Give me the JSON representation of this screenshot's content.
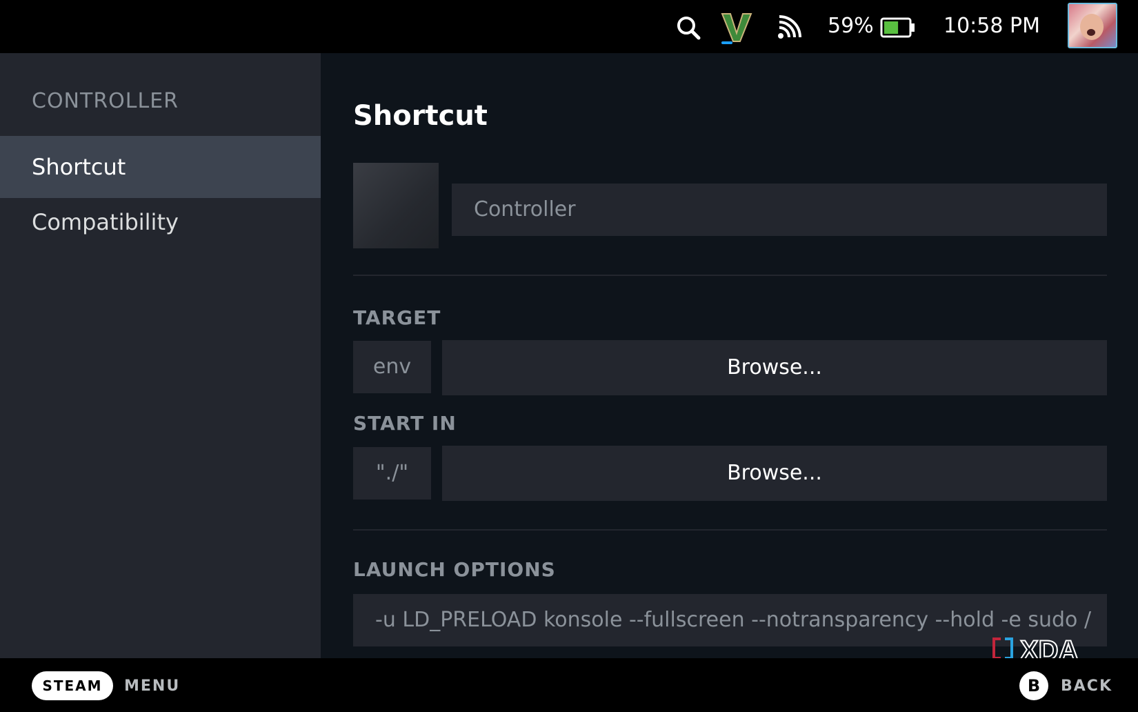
{
  "topbar": {
    "battery_percent": "59%",
    "battery_level": 0.59,
    "time": "10:58 PM",
    "icons": [
      "search-icon",
      "game-icon",
      "wifi-icon",
      "battery-icon",
      "avatar"
    ]
  },
  "sidebar": {
    "section_title": "CONTROLLER",
    "items": [
      {
        "label": "Shortcut",
        "active": true
      },
      {
        "label": "Compatibility",
        "active": false
      }
    ]
  },
  "main": {
    "title": "Shortcut",
    "name_field_value": "Controller",
    "target": {
      "label": "TARGET",
      "prefix": "env",
      "browse_label": "Browse..."
    },
    "start_in": {
      "label": "START IN",
      "prefix": "\"./\"",
      "browse_label": "Browse..."
    },
    "launch_options": {
      "label": "LAUNCH OPTIONS",
      "value": "-u LD_PRELOAD konsole --fullscreen --notransparency --hold -e sudo /"
    }
  },
  "watermark": "XDA",
  "footer": {
    "steam_label": "STEAM",
    "menu_label": "MENU",
    "b_label": "B",
    "back_label": "BACK"
  },
  "colors": {
    "accent": "#1a9fff",
    "sidebar_bg": "#23262e",
    "sidebar_active": "#3d4450",
    "main_bg": "#0e141b",
    "battery_fill": "#59bf40"
  }
}
